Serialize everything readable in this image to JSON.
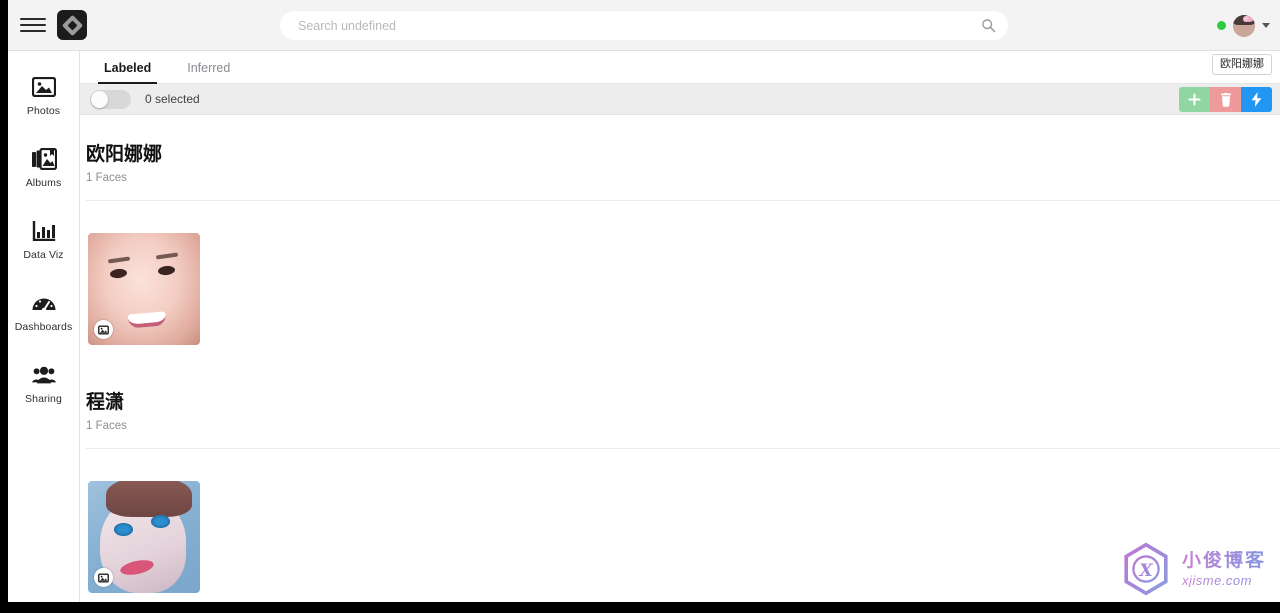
{
  "topbar": {
    "menu_icon": "hamburger-icon",
    "logo_icon": "app-logo-diamond-icon",
    "search": {
      "placeholder": "Search undefined",
      "value": "",
      "icon": "search-icon"
    },
    "status_indicator": "online-status-dot",
    "avatar": "user-avatar",
    "caret": "chevron-down-icon"
  },
  "sidebar": {
    "items": [
      {
        "label": "Photos",
        "icon": "photos-icon"
      },
      {
        "label": "Albums",
        "icon": "albums-icon"
      },
      {
        "label": "Data Viz",
        "icon": "data-viz-icon"
      },
      {
        "label": "Dashboards",
        "icon": "dashboards-gauge-icon"
      },
      {
        "label": "Sharing",
        "icon": "sharing-people-icon"
      }
    ]
  },
  "tabs": {
    "items": [
      {
        "label": "Labeled",
        "active": true
      },
      {
        "label": "Inferred",
        "active": false
      }
    ],
    "filter_chip": "欧阳娜娜"
  },
  "toolbar": {
    "select_all_toggle": "off",
    "selected_text": "0 selected",
    "actions": [
      {
        "name": "add-button",
        "icon": "plus-icon",
        "color": "#8fd6a0"
      },
      {
        "name": "delete-button",
        "icon": "trash-icon",
        "color": "#ef9a9a"
      },
      {
        "name": "scan-button",
        "icon": "lightning-icon",
        "color": "#2196f3"
      }
    ]
  },
  "face_groups": [
    {
      "name": "欧阳娜娜",
      "count_text": "1 Faces",
      "photos": [
        {
          "badge_icon": "image-badge-icon",
          "alt": "face-thumbnail"
        }
      ]
    },
    {
      "name": "程潇",
      "count_text": "1 Faces",
      "photos": [
        {
          "badge_icon": "image-badge-icon",
          "alt": "face-thumbnail"
        }
      ]
    }
  ],
  "watermark": {
    "cn": "小俊博客",
    "en": "xjisme.com",
    "mark": "X"
  },
  "colors": {
    "accent_blue": "#2196f3",
    "add_green": "#8fd6a0",
    "delete_red": "#ef9a9a",
    "status_green": "#2ecc40",
    "topbar_bg": "#f3f3f3",
    "toolbar_bg": "#ededed"
  }
}
